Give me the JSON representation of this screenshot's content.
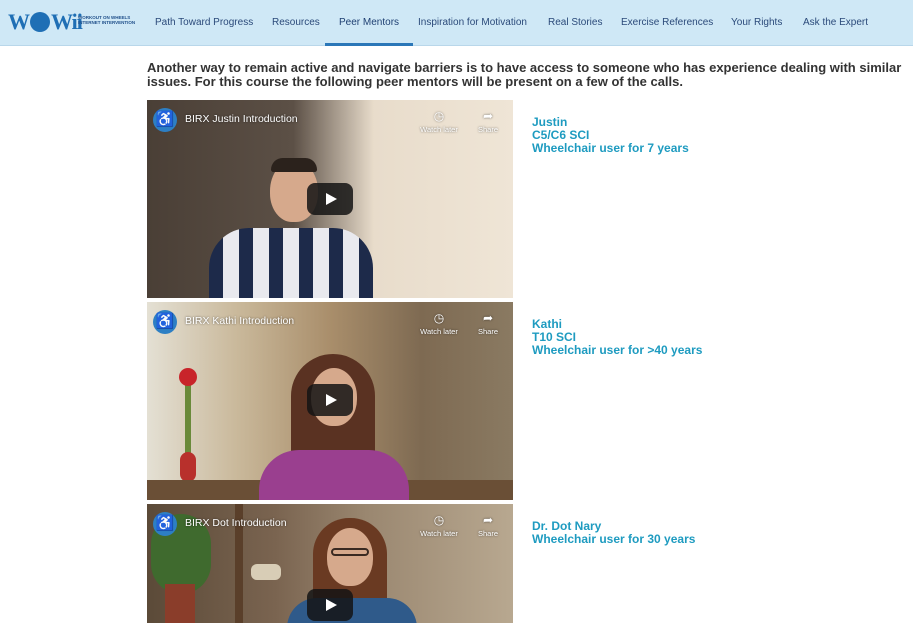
{
  "logo": {
    "word": "WOWii",
    "tagline": "Workout on Wheels Internet Intervention"
  },
  "nav": {
    "items": [
      {
        "label": "Path Toward Progress"
      },
      {
        "label": "Resources"
      },
      {
        "label": "Peer Mentors"
      },
      {
        "label": "Inspiration for Motivation"
      },
      {
        "label": "Real Stories"
      },
      {
        "label": "Exercise References"
      },
      {
        "label": "Your Rights"
      },
      {
        "label": "Ask the Expert"
      }
    ],
    "active": "Peer Mentors"
  },
  "intro": "Another way to remain active and navigate barriers is to have access to someone who has experience dealing with similar issues. For this course the following peer mentors will be present on a few of the calls.",
  "videos": [
    {
      "title": "BIRX Justin Introduction",
      "watch_later": "Watch later",
      "share": "Share"
    },
    {
      "title": "BIRX Kathi Introduction",
      "watch_later": "Watch later",
      "share": "Share"
    },
    {
      "title": "BIRX Dot Introduction",
      "watch_later": "Watch later",
      "share": "Share"
    }
  ],
  "mentors": [
    {
      "name": "Justin",
      "line2": "C5/C6 SCI",
      "line3": "Wheelchair user for 7 years"
    },
    {
      "name": "Kathi",
      "line2": "T10 SCI",
      "line3": "Wheelchair user for >40 years"
    },
    {
      "name": "Dr. Dot Nary",
      "line2": "Wheelchair user for 30 years"
    }
  ],
  "icons": {
    "channel_avatar": "wheelchair-icon",
    "watch_later": "clock-icon",
    "share": "share-arrow-icon",
    "play": "play-icon"
  },
  "colors": {
    "nav_bg": "#cfe8f6",
    "nav_text": "#2b4a7a",
    "mentor_text": "#1e9bc0",
    "intro_text": "#333333"
  }
}
